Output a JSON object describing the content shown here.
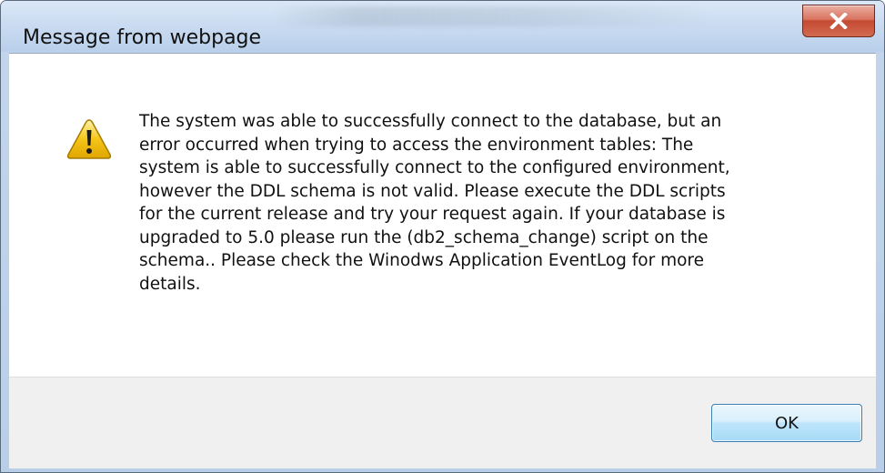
{
  "window": {
    "title": "Message from webpage"
  },
  "dialog": {
    "message": "The system was able to successfully connect to the database, but an\nerror occurred when trying to access the environment tables: The\nsystem is able to successfully connect to the configured environment,\nhowever the DDL schema is not valid.  Please execute the DDL scripts\nfor the current release and try your request again.  If your database is\nupgraded to 5.0 please run the (db2_schema_change) script on the\nschema..  Please check the Winodws Application EventLog for more\ndetails.",
    "icon": "warning-icon",
    "ok_label": "OK"
  },
  "colors": {
    "close_button": "#c44a33",
    "ok_button": "#bee6fd",
    "warning_fill": "#f5c518"
  }
}
